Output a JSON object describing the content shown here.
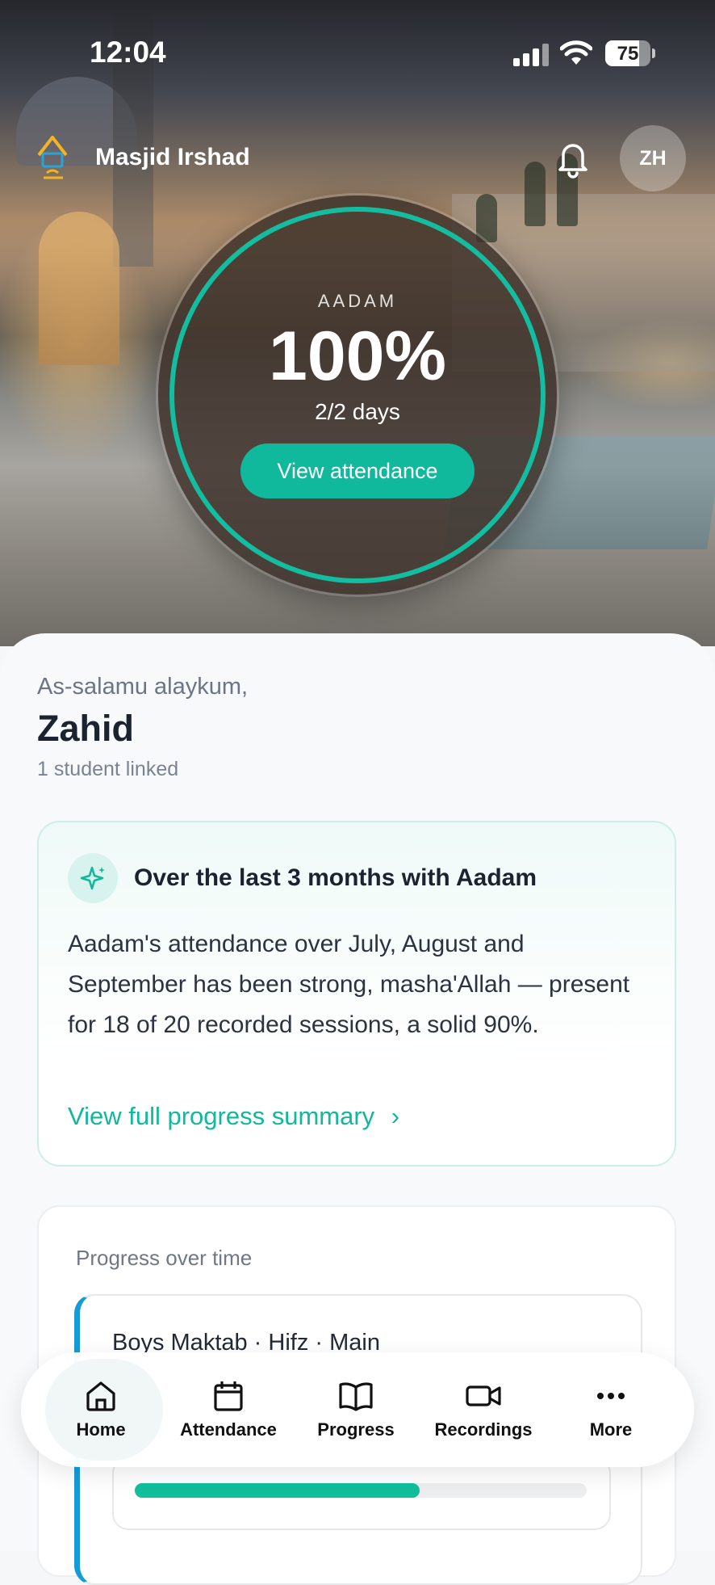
{
  "status_bar": {
    "time": "12:04",
    "battery": "75",
    "battery_level": 0.75
  },
  "header": {
    "org_name": "Masjid Irshad",
    "avatar_initials": "ZH"
  },
  "attendance": {
    "student": "AADAM",
    "percent": "100%",
    "days": "2/2 days",
    "button_label": "View attendance",
    "accent": "#14bca0"
  },
  "welcome": {
    "greeting": "As-salamu alaykum,",
    "name": "Zahid",
    "linked": "1 student linked"
  },
  "summary": {
    "title": "Over the last 3 months with Aadam",
    "body": "Aadam's attendance over July, August and September has been strong, masha'Allah — present for 18 of 20 recorded sessions, a solid 90%.",
    "link_label": "View full progress summary"
  },
  "progress": {
    "heading": "Progress over time",
    "course": "Boys Maktab · Hifz · Main",
    "progress_fraction": 0.63,
    "bar_color": "#12bf9b"
  },
  "nav": {
    "items": [
      {
        "label": "Home",
        "icon": "home-icon",
        "active": true
      },
      {
        "label": "Attendance",
        "icon": "calendar-icon",
        "active": false
      },
      {
        "label": "Progress",
        "icon": "book-icon",
        "active": false
      },
      {
        "label": "Recordings",
        "icon": "video-icon",
        "active": false
      },
      {
        "label": "More",
        "icon": "more-icon",
        "active": false
      }
    ]
  }
}
